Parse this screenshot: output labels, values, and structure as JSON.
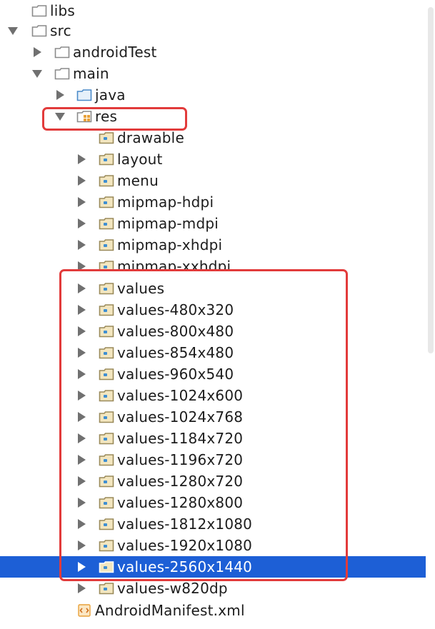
{
  "tree": {
    "rows": [
      {
        "label": "libs",
        "arrow": "none",
        "icon": "folder-icon"
      },
      {
        "label": "src",
        "arrow": "down",
        "icon": "folder-icon"
      },
      {
        "label": "androidTest",
        "arrow": "right",
        "icon": "folder-icon"
      },
      {
        "label": "main",
        "arrow": "down",
        "icon": "folder-icon"
      },
      {
        "label": "java",
        "arrow": "right",
        "icon": "source-folder-icon"
      },
      {
        "label": "res",
        "arrow": "down",
        "icon": "resource-folder-icon"
      },
      {
        "label": "drawable",
        "arrow": "none",
        "icon": "package-folder-icon"
      },
      {
        "label": "layout",
        "arrow": "right",
        "icon": "package-folder-icon"
      },
      {
        "label": "menu",
        "arrow": "right",
        "icon": "package-folder-icon"
      },
      {
        "label": "mipmap-hdpi",
        "arrow": "right",
        "icon": "package-folder-icon"
      },
      {
        "label": "mipmap-mdpi",
        "arrow": "right",
        "icon": "package-folder-icon"
      },
      {
        "label": "mipmap-xhdpi",
        "arrow": "right",
        "icon": "package-folder-icon"
      },
      {
        "label": "mipmap-xxhdpi",
        "arrow": "right",
        "icon": "package-folder-icon"
      },
      {
        "label": "values",
        "arrow": "right",
        "icon": "package-folder-icon"
      },
      {
        "label": "values-480x320",
        "arrow": "right",
        "icon": "package-folder-icon"
      },
      {
        "label": "values-800x480",
        "arrow": "right",
        "icon": "package-folder-icon"
      },
      {
        "label": "values-854x480",
        "arrow": "right",
        "icon": "package-folder-icon"
      },
      {
        "label": "values-960x540",
        "arrow": "right",
        "icon": "package-folder-icon"
      },
      {
        "label": "values-1024x600",
        "arrow": "right",
        "icon": "package-folder-icon"
      },
      {
        "label": "values-1024x768",
        "arrow": "right",
        "icon": "package-folder-icon"
      },
      {
        "label": "values-1184x720",
        "arrow": "right",
        "icon": "package-folder-icon"
      },
      {
        "label": "values-1196x720",
        "arrow": "right",
        "icon": "package-folder-icon"
      },
      {
        "label": "values-1280x720",
        "arrow": "right",
        "icon": "package-folder-icon"
      },
      {
        "label": "values-1280x800",
        "arrow": "right",
        "icon": "package-folder-icon"
      },
      {
        "label": "values-1812x1080",
        "arrow": "right",
        "icon": "package-folder-icon"
      },
      {
        "label": "values-1920x1080",
        "arrow": "right",
        "icon": "package-folder-icon"
      },
      {
        "label": "values-2560x1440",
        "arrow": "right",
        "icon": "package-folder-icon",
        "selected": true
      },
      {
        "label": "values-w820dp",
        "arrow": "right",
        "icon": "package-folder-icon"
      },
      {
        "label": "AndroidManifest.xml",
        "arrow": "none",
        "icon": "xml-file-icon"
      }
    ]
  },
  "colors": {
    "selection": "#1d5fd6",
    "highlight_box": "#e23b3b",
    "folder_fill": "#f3e6bf",
    "folder_stroke": "#9a8a5a",
    "source_folder_stroke": "#4a8ac9",
    "package_dot": "#3f8fd2",
    "xml_icon": "#e8a13a"
  }
}
